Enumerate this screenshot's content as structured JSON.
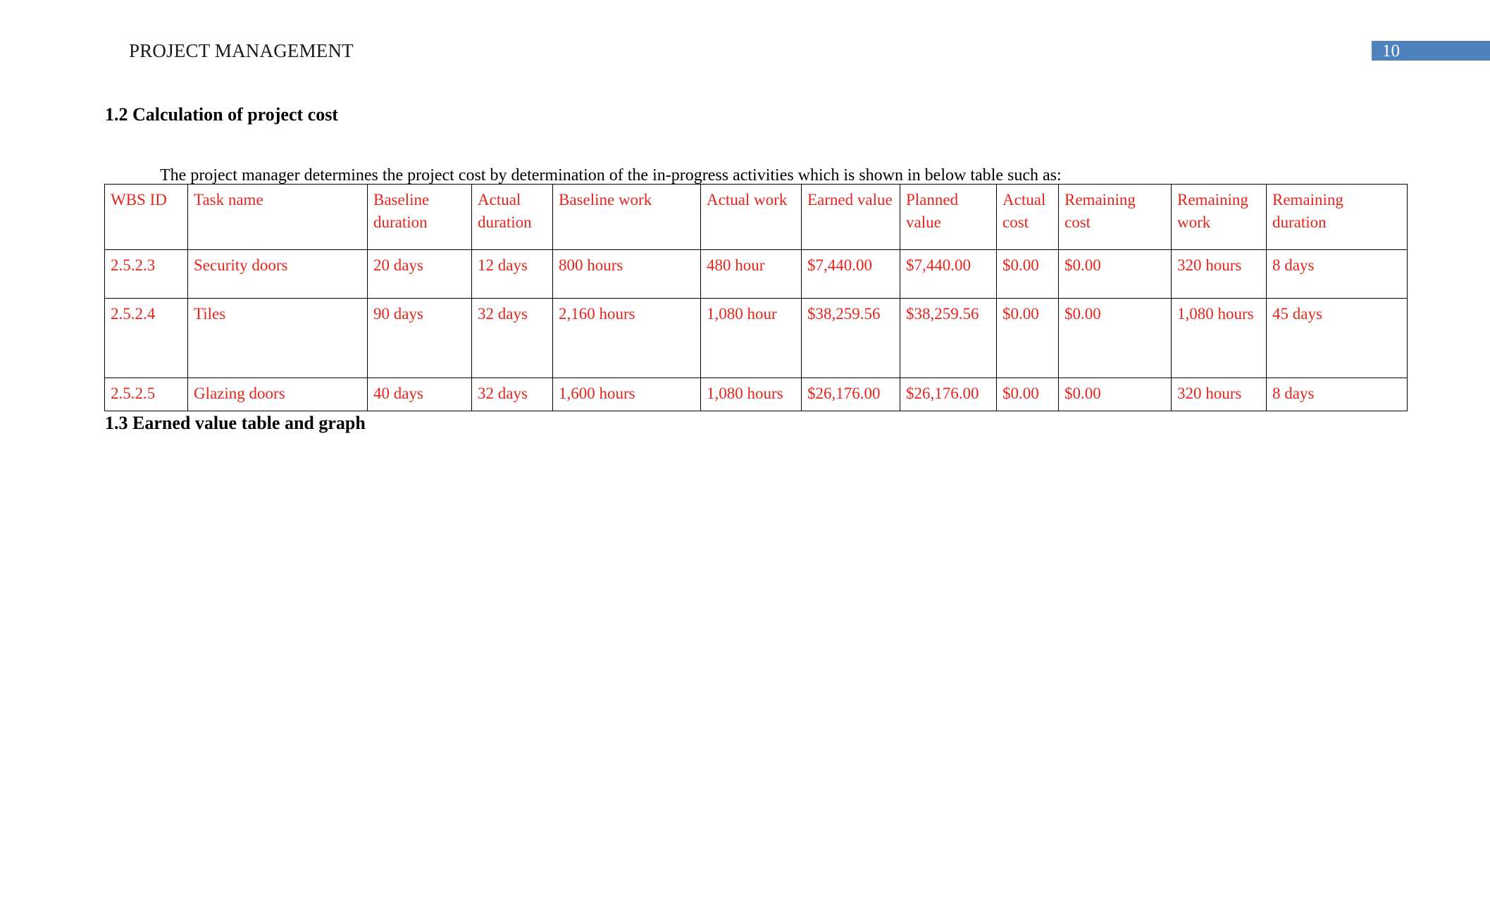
{
  "header": {
    "title": "PROJECT MANAGEMENT",
    "page_number": "10",
    "banner_color": "#4f81bd"
  },
  "document": {
    "headings": {
      "section_1_2": "1.2 Calculation of project cost",
      "section_1_3": "1.3 Earned value table and graph"
    },
    "paragraph": "The project manager determines the project cost by determination of the in-progress activities which is shown in below table such as:"
  },
  "table": {
    "text_color": "#e8241c",
    "columns": [
      "WBS ID",
      "Task name",
      "Baseline duration",
      "Actual duration",
      "Baseline work",
      "Actual work",
      "Earned value",
      "Planned value",
      "Actual cost",
      "Remaining cost",
      "Remaining work",
      "Remaining duration"
    ],
    "rows": [
      {
        "wbs_id": "2.5.2.3",
        "task_name": "Security doors",
        "baseline_duration": "20 days",
        "actual_duration": "12 days",
        "baseline_work": "800 hours",
        "actual_work": "480 hour",
        "earned_value": "$7,440.00",
        "planned_value": "$7,440.00",
        "actual_cost": "$0.00",
        "remaining_cost": "$0.00",
        "remaining_work": "320 hours",
        "remaining_duration": "8 days"
      },
      {
        "wbs_id": "2.5.2.4",
        "task_name": "Tiles",
        "baseline_duration": "90 days",
        "actual_duration": "32 days",
        "baseline_work": "2,160 hours",
        "actual_work": "1,080 hour",
        "earned_value": "$38,259.56",
        "planned_value": "$38,259.56",
        "actual_cost": "$0.00",
        "remaining_cost": "$0.00",
        "remaining_work": "1,080 hours",
        "remaining_duration": "45 days"
      },
      {
        "wbs_id": "2.5.2.5",
        "task_name": "Glazing doors",
        "baseline_duration": "40 days",
        "actual_duration": "32 days",
        "baseline_work": "1,600 hours",
        "actual_work": "1,080 hours",
        "earned_value": "$26,176.00",
        "planned_value": "$26,176.00",
        "actual_cost": "$0.00",
        "remaining_cost": "$0.00",
        "remaining_work": "320 hours",
        "remaining_duration": "8 days"
      }
    ]
  }
}
